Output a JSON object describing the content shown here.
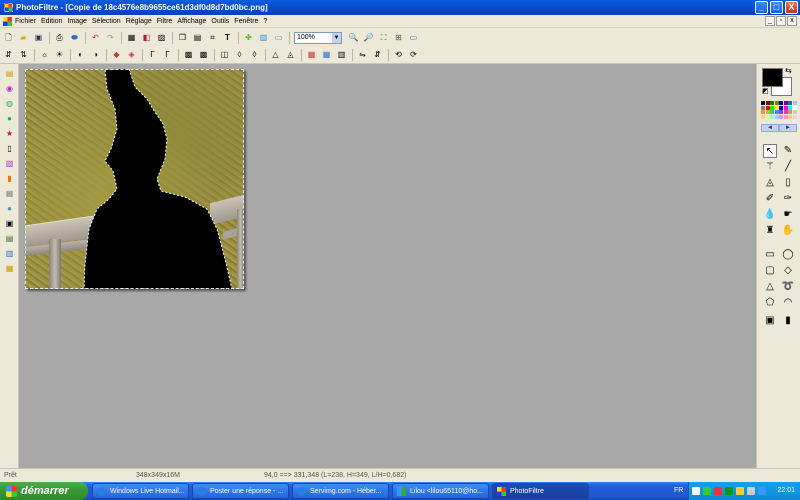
{
  "window": {
    "title": "PhotoFiltre - [Copie de 18c4576e8b9655ce61d3df0d8d7bd0bc.png]",
    "buttons": {
      "minimize": "_",
      "maximize": "□",
      "close": "X"
    }
  },
  "menu": [
    "Fichier",
    "Edition",
    "Image",
    "Sélection",
    "Réglage",
    "Filtre",
    "Affichage",
    "Outils",
    "Fenêtre",
    "?"
  ],
  "mdi_buttons": {
    "minimize": "_",
    "restore": "▫",
    "close": "x"
  },
  "toolbar": {
    "zoom": "100%"
  },
  "status": {
    "state": "Prêt",
    "dimensions": "348x349x16M",
    "coords": "94,0 ==> 331,348 (L=238, H=349, L/H=0,682)"
  },
  "taskbar": {
    "start_label": "démarrer",
    "tasks": [
      {
        "label": "Windows Live Hotmail...",
        "icon": "ie-icon"
      },
      {
        "label": "Poster une réponse - ...",
        "icon": "ie-icon"
      },
      {
        "label": "Servimg.com - Héber...",
        "icon": "ie-icon"
      },
      {
        "label": "Lilou <lilou65110@ho...",
        "icon": "messenger-icon"
      },
      {
        "label": "PhotoFiltre",
        "icon": "photofiltre-icon",
        "active": true
      }
    ],
    "lang": "FR",
    "clock": "22:01"
  },
  "colors": {
    "foreground": "#000000",
    "background": "#ffffff",
    "title_bar": "#0a4ad0",
    "workspace": "#a8a8a8"
  }
}
